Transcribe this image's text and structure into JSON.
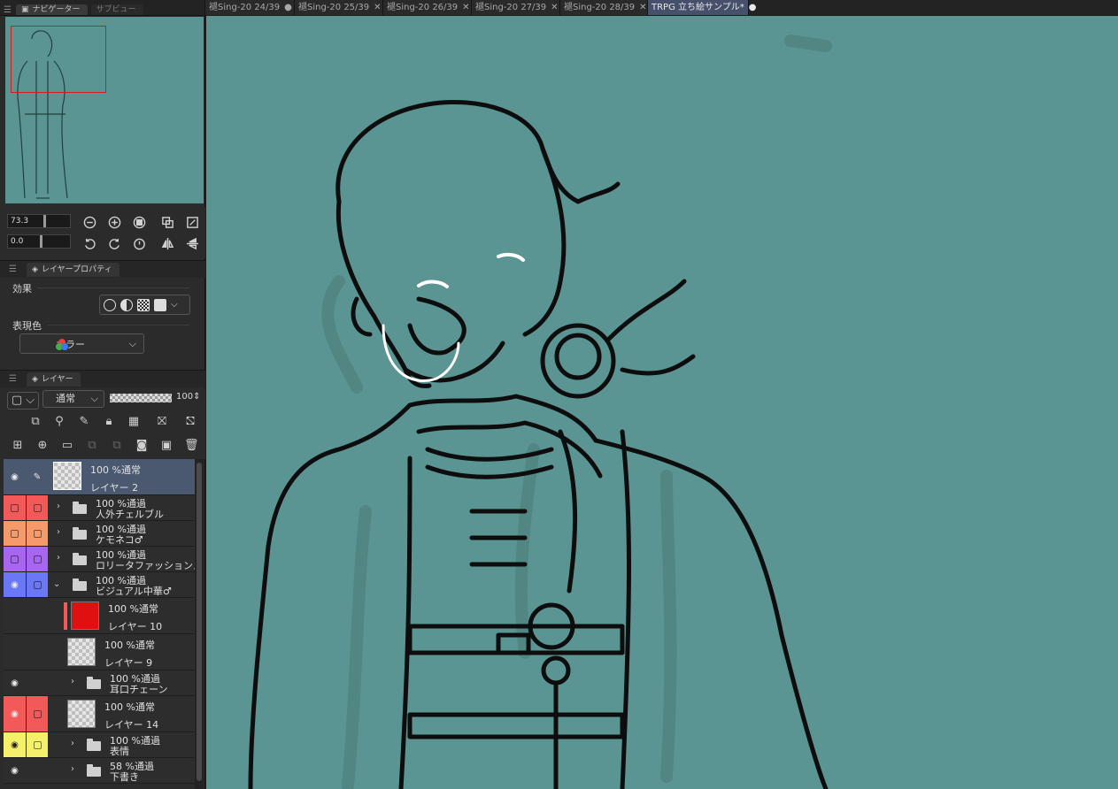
{
  "navigator": {
    "tab_label": "ナビゲーター",
    "tab2_label": "サブビュー",
    "zoom_value": "73.3",
    "angle_value": "0.0"
  },
  "properties": {
    "tab_label": "レイヤープロパティ",
    "effect_label": "効果",
    "color_label": "表現色",
    "color_value": "カラー"
  },
  "layers": {
    "tab_label": "レイヤー",
    "blend_mode": "通常",
    "opacity": "100",
    "rows": [
      {
        "line1": "100 %通常",
        "line2": "レイヤー 2",
        "type": "layer",
        "color": "",
        "selected": true
      },
      {
        "line1": "100 %通過",
        "line2": "人外チェルブル",
        "type": "folder",
        "color": "#f25a5a"
      },
      {
        "line1": "100 %通過",
        "line2": "ケモネコ♂",
        "type": "folder",
        "color": "#f59a6a"
      },
      {
        "line1": "100 %通過",
        "line2": "ロリータファッションメス",
        "type": "folder",
        "color": "#a865f0"
      },
      {
        "line1": "100 %通過",
        "line2": "ビジュアル中華♂",
        "type": "folder",
        "color": "#6a78f5",
        "open": true
      },
      {
        "line1": "100 %通常",
        "line2": "レイヤー 10",
        "type": "layer",
        "color": ""
      },
      {
        "line1": "100 %通常",
        "line2": "レイヤー 9",
        "type": "layer",
        "color": ""
      },
      {
        "line1": "100 %通過",
        "line2": "耳口チェーン",
        "type": "folder",
        "color": ""
      },
      {
        "line1": "100 %通常",
        "line2": "レイヤー 14",
        "type": "layer",
        "color": "#f25a5a"
      },
      {
        "line1": "100 %通過",
        "line2": "表情",
        "type": "folder",
        "color": "#f5f06a"
      },
      {
        "line1": "58 %通過",
        "line2": "下書き",
        "type": "folder",
        "color": ""
      }
    ]
  },
  "doc_tabs": [
    {
      "label": "褪Sing-20 24/39",
      "active": false
    },
    {
      "label": "褪Sing-20 25/39",
      "active": false
    },
    {
      "label": "褪Sing-20 26/39",
      "active": false
    },
    {
      "label": "褪Sing-20 27/39",
      "active": false
    },
    {
      "label": "褪Sing-20 28/39",
      "active": false
    },
    {
      "label": "TRPG 立ち絵サンプル*",
      "active": true
    }
  ],
  "colors": {
    "canvas_bg": "#5b9593",
    "accent": "#46506a",
    "nav_frame": "#d61a1a"
  }
}
